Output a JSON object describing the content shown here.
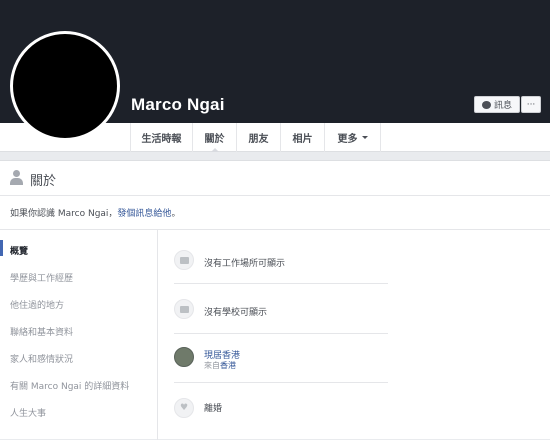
{
  "profile": {
    "name": "Marco Ngai",
    "message_label": "訊息",
    "more_label": "···"
  },
  "tabs": [
    {
      "label": "生活時報"
    },
    {
      "label": "關於"
    },
    {
      "label": "朋友"
    },
    {
      "label": "相片"
    },
    {
      "label": "更多"
    }
  ],
  "about": {
    "title": "關於",
    "notice_prefix": "如果你認識 Marco Ngai，",
    "notice_link": "發個訊息給他",
    "notice_suffix": "。"
  },
  "sidebar": {
    "items": [
      {
        "label": "概覽"
      },
      {
        "label": "學歷與工作經歷"
      },
      {
        "label": "他住過的地方"
      },
      {
        "label": "聯絡和基本資料"
      },
      {
        "label": "家人和感情狀況"
      },
      {
        "label": "有關 Marco Ngai 的詳細資料"
      },
      {
        "label": "人生大事"
      }
    ]
  },
  "overview": {
    "work": "沒有工作場所可顯示",
    "school": "沒有學校可顯示",
    "location_title": "現居香港",
    "location_from_prefix": "來自",
    "location_from": "香港",
    "relationship": "離婚"
  },
  "icons": {
    "work": "briefcase-icon",
    "school": "school-icon",
    "location": "location-photo-icon",
    "relationship": "heart-icon"
  },
  "colors": {
    "cover": "#1d2129",
    "link": "#365899",
    "background": "#e9ebee"
  }
}
